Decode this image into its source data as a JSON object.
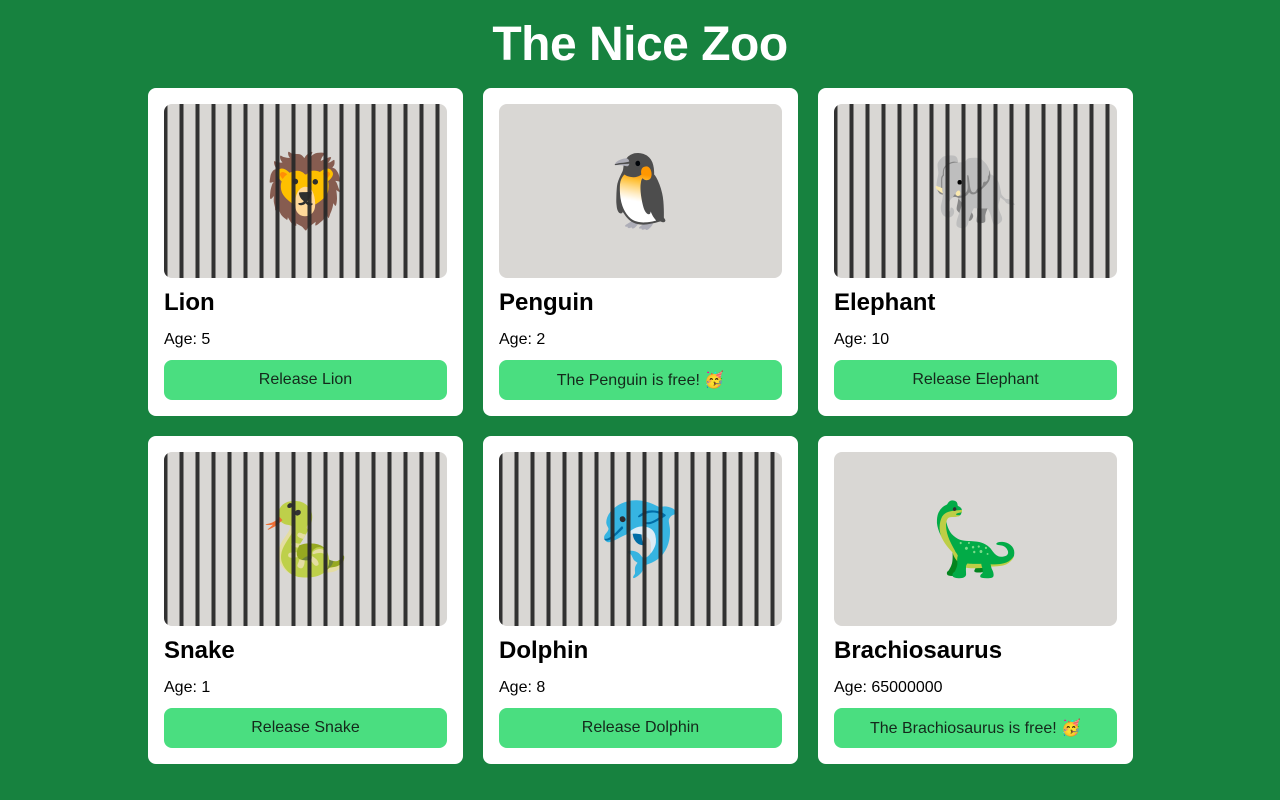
{
  "page": {
    "title": "The Nice Zoo"
  },
  "animals": [
    {
      "name": "Lion",
      "emoji": "🦁",
      "age_label": "Age: 5",
      "caged": true,
      "button_label": "Release Lion"
    },
    {
      "name": "Penguin",
      "emoji": "🐧",
      "age_label": "Age: 2",
      "caged": false,
      "button_label": "The Penguin is free! 🥳"
    },
    {
      "name": "Elephant",
      "emoji": "🐘",
      "age_label": "Age: 10",
      "caged": true,
      "button_label": "Release Elephant"
    },
    {
      "name": "Snake",
      "emoji": "🐍",
      "age_label": "Age: 1",
      "caged": true,
      "button_label": "Release Snake"
    },
    {
      "name": "Dolphin",
      "emoji": "🐬",
      "age_label": "Age: 8",
      "caged": true,
      "button_label": "Release Dolphin"
    },
    {
      "name": "Brachiosaurus",
      "emoji": "🦕",
      "age_label": "Age: 65000000",
      "caged": false,
      "button_label": "The Brachiosaurus is free! 🥳"
    }
  ],
  "colors": {
    "background": "#17823f",
    "card": "#ffffff",
    "button": "#4ade80",
    "enclosure": "#d9d7d4"
  }
}
